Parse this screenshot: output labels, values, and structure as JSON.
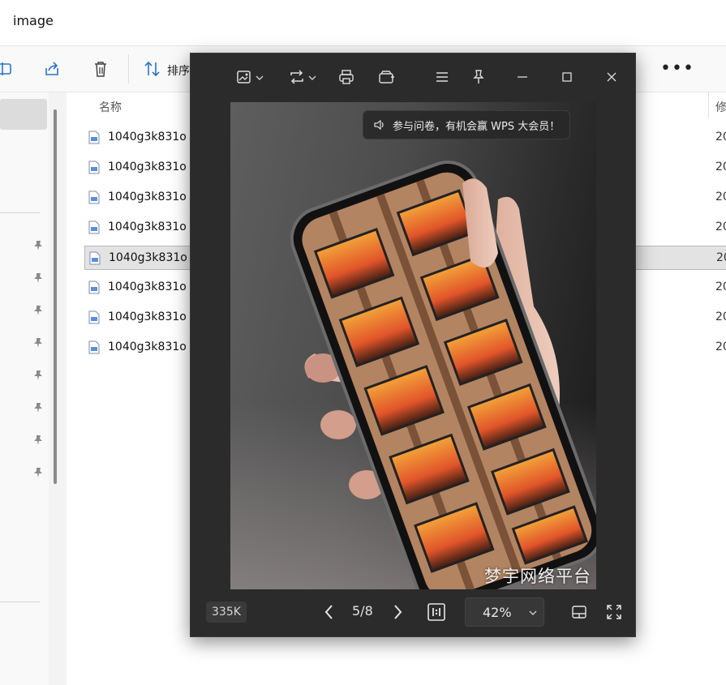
{
  "window": {
    "title": "image"
  },
  "toolbar": {
    "sort_label": "排序"
  },
  "file_list": {
    "col_name": "名称",
    "col_modified": "修",
    "rows": [
      {
        "name": "1040g3k831o",
        "date": "20",
        "selected": false
      },
      {
        "name": "1040g3k831o",
        "date": "20",
        "selected": false
      },
      {
        "name": "1040g3k831o",
        "date": "20",
        "selected": false
      },
      {
        "name": "1040g3k831o",
        "date": "20",
        "selected": false
      },
      {
        "name": "1040g3k831o",
        "date": "20",
        "selected": true
      },
      {
        "name": "1040g3k831o",
        "date": "20",
        "selected": false
      },
      {
        "name": "1040g3k831o",
        "date": "20",
        "selected": false
      },
      {
        "name": "1040g3k831o",
        "date": "20",
        "selected": false
      }
    ]
  },
  "viewer": {
    "banner": "参与问卷，有机会赢 WPS 大会员！",
    "watermark": "梦宇网络平台",
    "file_size": "335K",
    "page_indicator": "5/8",
    "zoom": "42%",
    "icons": [
      "edit-image-icon",
      "rotate-icon",
      "print-icon",
      "wallet-icon",
      "menu-icon",
      "pin-icon",
      "minimize-icon",
      "maximize-icon",
      "close-icon",
      "prev-icon",
      "next-icon",
      "actual-size-icon",
      "thumbnail-icon",
      "fullscreen-icon"
    ]
  },
  "colors": {
    "viewer_bg": "#2b2b2b",
    "explorer_bg": "#f3f3f3",
    "selection": "#e3e3e3"
  }
}
